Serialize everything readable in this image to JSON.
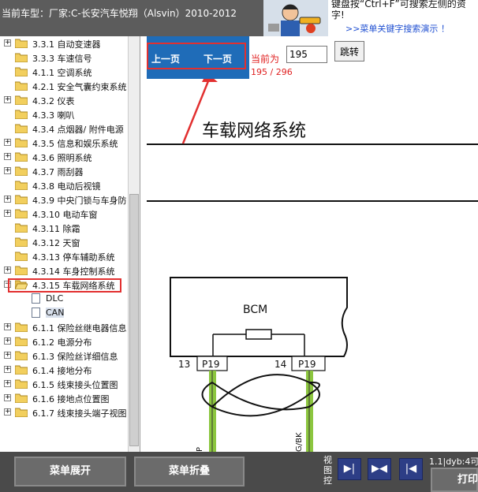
{
  "header": {
    "vehicle_title": "当前车型：厂家:C-长安汽车悦翔（Alsvin）2010-2012",
    "tip_line1": "键盘按“Ctrl+F”可搜索左侧的资",
    "tip_line2": "字!",
    "tip_link": ">>菜单关键字搜索演示 ！"
  },
  "tree": {
    "items": [
      {
        "label": "3.3.1 自动变速器",
        "type": "folder",
        "expander": "+"
      },
      {
        "label": "3.3.3 车速信号",
        "type": "folder",
        "expander": ""
      },
      {
        "label": "4.1.1 空调系统",
        "type": "folder",
        "expander": ""
      },
      {
        "label": "4.2.1 安全气囊约束系统",
        "type": "folder",
        "expander": ""
      },
      {
        "label": "4.3.2 仪表",
        "type": "folder",
        "expander": "+"
      },
      {
        "label": "4.3.3 喇叭",
        "type": "folder",
        "expander": ""
      },
      {
        "label": "4.3.4 点烟器/ 附件电源",
        "type": "folder",
        "expander": ""
      },
      {
        "label": "4.3.5 信息和娱乐系统",
        "type": "folder",
        "expander": "+"
      },
      {
        "label": "4.3.6 照明系统",
        "type": "folder",
        "expander": "+"
      },
      {
        "label": "4.3.7 雨刮器",
        "type": "folder",
        "expander": "+"
      },
      {
        "label": "4.3.8 电动后视镜",
        "type": "folder",
        "expander": ""
      },
      {
        "label": "4.3.9 中央门锁与车身防",
        "type": "folder",
        "expander": "+"
      },
      {
        "label": "4.3.10 电动车窗",
        "type": "folder",
        "expander": "+"
      },
      {
        "label": "4.3.11 除霜",
        "type": "folder",
        "expander": ""
      },
      {
        "label": "4.3.12 天窗",
        "type": "folder",
        "expander": ""
      },
      {
        "label": "4.3.13 停车辅助系统",
        "type": "folder",
        "expander": ""
      },
      {
        "label": "4.3.14 车身控制系统",
        "type": "folder",
        "expander": "+"
      },
      {
        "label": "4.3.15 车载网络系统",
        "type": "folder-open",
        "expander": "-"
      },
      {
        "label": "DLC",
        "type": "doc",
        "expander": ""
      },
      {
        "label": "CAN",
        "type": "doc",
        "expander": "",
        "selected": true
      },
      {
        "label": "6.1.1 保险丝继电器信息",
        "type": "folder",
        "expander": "+"
      },
      {
        "label": "6.1.2 电源分布",
        "type": "folder",
        "expander": "+"
      },
      {
        "label": "6.1.3 保险丝详细信息",
        "type": "folder",
        "expander": "+"
      },
      {
        "label": "6.1.4 接地分布",
        "type": "folder",
        "expander": "+"
      },
      {
        "label": "6.1.5 线束接头位置图",
        "type": "folder",
        "expander": "+"
      },
      {
        "label": "6.1.6 接地点位置图",
        "type": "folder",
        "expander": "+"
      },
      {
        "label": "6.1.7 线束接头端子视图",
        "type": "folder",
        "expander": "+"
      }
    ]
  },
  "nav": {
    "prev_label": "上一页",
    "next_label": "下一页",
    "current_label": "当前为",
    "page_value": "195",
    "jump_label": "跳转",
    "page_count": "195 / 296"
  },
  "document": {
    "title": "车载网络系统",
    "module_label": "BCM",
    "pin_left_num": "13",
    "pin_left_conn": "P19",
    "pin_right_num": "14",
    "pin_right_conn": "P19",
    "wire_right_label": "G/BK",
    "wire_left_label": "P"
  },
  "bottom": {
    "expand_label": "菜单展开",
    "collapse_label": "菜单折叠",
    "view_control_label": "视图控",
    "status_text": "1.1|dyb:4可",
    "print_label": "打印"
  },
  "colors": {
    "header_bg": "#5c5c5c",
    "nav_blue": "#1f6cb8",
    "highlight_red": "#e23030",
    "wire_green": "#8cc63f",
    "bottom_bg": "#4a4a4a"
  }
}
